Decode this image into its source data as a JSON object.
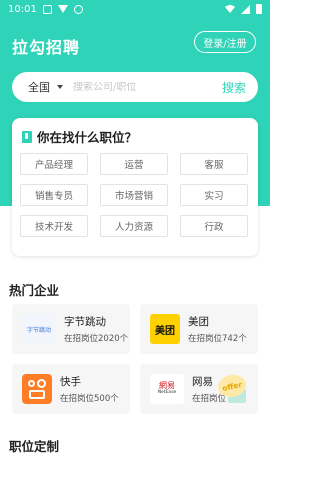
{
  "status_bar": {
    "time": "10:01",
    "icons": [
      "mail-icon",
      "download-icon",
      "settings-icon",
      "wifi-icon",
      "signal-icon",
      "battery-icon"
    ]
  },
  "header": {
    "app_title": "拉勾招聘",
    "login_label": "登录/注册"
  },
  "search": {
    "city": "全国",
    "placeholder": "搜索公司/职位",
    "button_label": "搜索"
  },
  "job_finder": {
    "title": "你在找什么职位？",
    "tags": [
      "产品经理",
      "运营",
      "客服",
      "销售专员",
      "市场营销",
      "实习",
      "技术开发",
      "人力资源",
      "行政"
    ]
  },
  "hot_companies": {
    "title": "热门企业",
    "items": [
      {
        "name": "字节跳动",
        "jobs": "在招岗位2020个",
        "logo_text": "字节跳动",
        "logo_icon": "bytedance-logo"
      },
      {
        "name": "美团",
        "jobs": "在招岗位742个",
        "logo_text": "美团",
        "logo_icon": "meituan-logo"
      },
      {
        "name": "快手",
        "jobs": "在招岗位500个",
        "logo_text": "",
        "logo_icon": "kuaishou-logo"
      },
      {
        "name": "网易",
        "jobs": "在招岗位",
        "logo_text": "網易",
        "logo_sub": "NetEase",
        "logo_icon": "netease-logo"
      }
    ],
    "offer_label": "offer"
  },
  "job_custom": {
    "title": "职位定制"
  },
  "colors": {
    "accent": "#2fd3b8",
    "meituan": "#ffd100",
    "kuaishou": "#ff7d26",
    "netease": "#d0161d"
  }
}
